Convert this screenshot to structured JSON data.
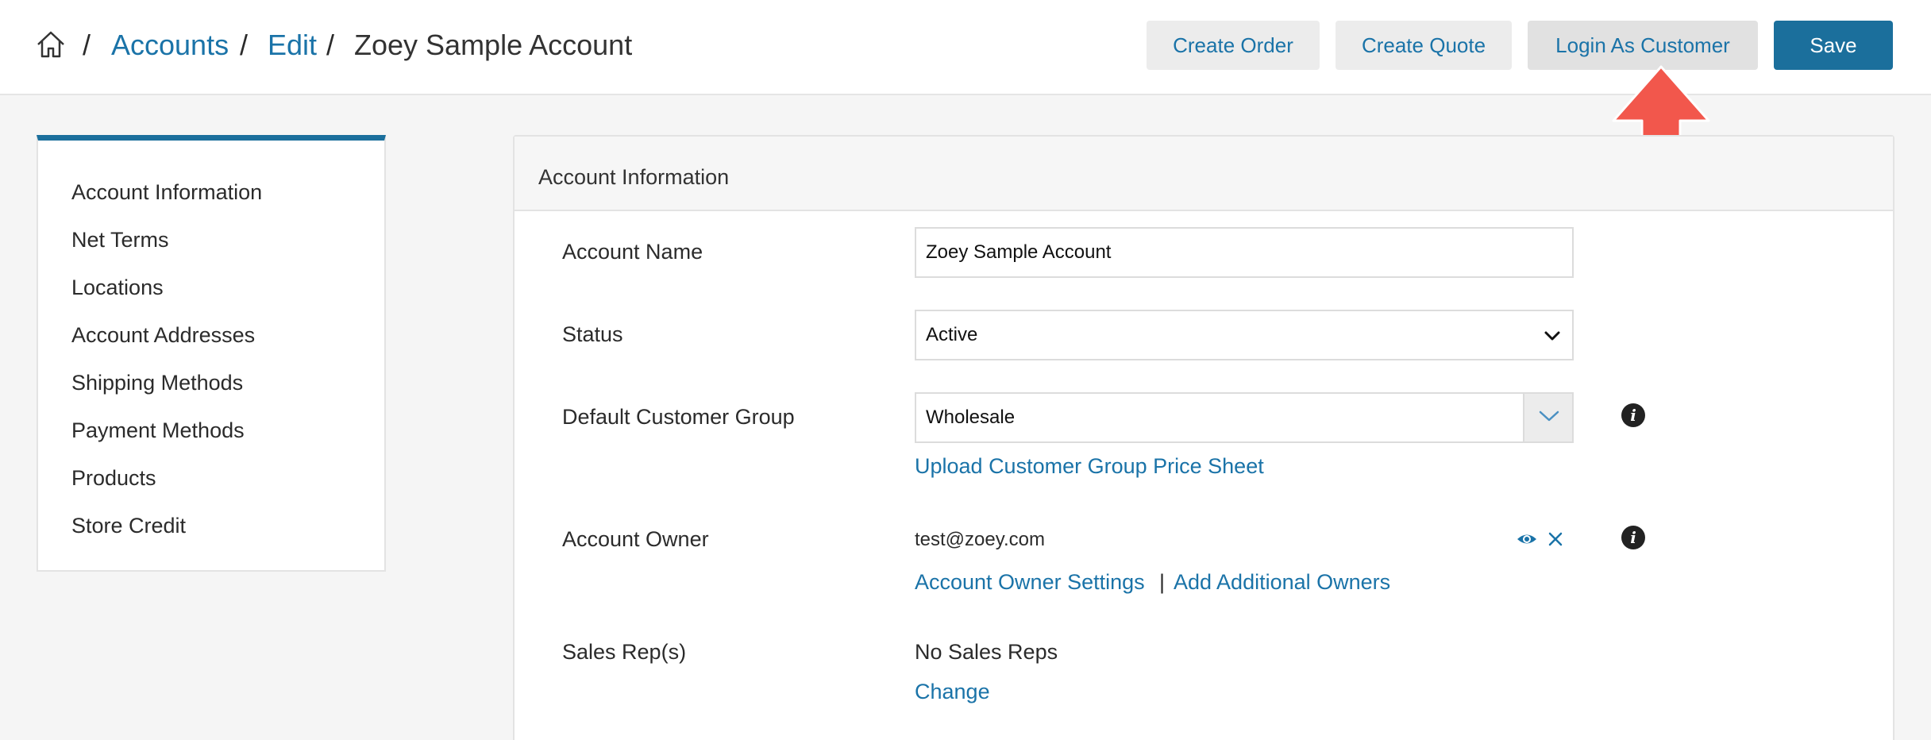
{
  "breadcrumb": {
    "separator": "/",
    "accounts": "Accounts",
    "edit": "Edit",
    "current": "Zoey Sample Account"
  },
  "header_buttons": {
    "create_order": "Create Order",
    "create_quote": "Create Quote",
    "login_as_customer": "Login As Customer",
    "save": "Save"
  },
  "sidebar": {
    "items": [
      {
        "label": "Account Information"
      },
      {
        "label": "Net Terms"
      },
      {
        "label": "Locations"
      },
      {
        "label": "Account Addresses"
      },
      {
        "label": "Shipping Methods"
      },
      {
        "label": "Payment Methods"
      },
      {
        "label": "Products"
      },
      {
        "label": "Store Credit"
      }
    ]
  },
  "panel": {
    "title": "Account Information",
    "account_name": {
      "label": "Account Name",
      "value": "Zoey Sample Account"
    },
    "status": {
      "label": "Status",
      "value": "Active"
    },
    "customer_group": {
      "label": "Default Customer Group",
      "value": "Wholesale",
      "upload_link": "Upload Customer Group Price Sheet"
    },
    "account_owner": {
      "label": "Account Owner",
      "email": "test@zoey.com",
      "settings_link": "Account Owner Settings",
      "divider": "|",
      "add_owners_link": "Add Additional Owners"
    },
    "sales_reps": {
      "label": "Sales Rep(s)",
      "value": "No Sales Reps",
      "change_link": "Change"
    }
  },
  "info_icon_glyph": "i",
  "annotation": {
    "color": "#f2574c",
    "icon": "up-arrow-icon"
  },
  "colors": {
    "primary": "#1b6f9c",
    "link": "#1a73a8"
  }
}
